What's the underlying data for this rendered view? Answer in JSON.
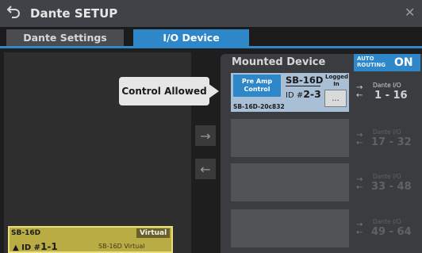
{
  "window": {
    "title": "Dante SETUP",
    "back_icon": "back-arrow-icon",
    "close_icon": "close-icon",
    "close_glyph": "✕"
  },
  "tabs": [
    {
      "label": "Dante Settings",
      "active": false
    },
    {
      "label": "I/O Device",
      "active": true
    }
  ],
  "local_device": {
    "name": "SB-16D",
    "badge": "Virtual",
    "id_prefix": "▲ ID #",
    "id_value": "1-1",
    "subtitle": "SB-16D Virtual"
  },
  "middle": {
    "right_arrow": "→",
    "left_arrow": "←"
  },
  "mounted": {
    "title": "Mounted Device",
    "auto_routing_label": "AUTO\nROUTING",
    "auto_routing_value": "ON",
    "slot1": {
      "preamp_label": "Pre Amp Control",
      "name": "SB-16D",
      "id_prefix": "ID #",
      "id_value": "2-3",
      "logged_in": "Logged In",
      "more_label": "...",
      "device_id": "SB-16D-20c832"
    },
    "io_ranges": [
      {
        "label": "Dante I/O",
        "range": "1 - 16",
        "active": true
      },
      {
        "label": "Dante I/O",
        "range": "17 - 32",
        "active": false
      },
      {
        "label": "Dante I/O",
        "range": "33 - 48",
        "active": false
      },
      {
        "label": "Dante I/O",
        "range": "49 - 64",
        "active": false
      }
    ],
    "arrow_glyphs": "→\n←"
  },
  "tooltip": {
    "text": "Control Allowed"
  },
  "colors": {
    "accent": "#2d87c8",
    "local_device": "#b9ac45",
    "slot_selected": "#a8bfd6"
  }
}
